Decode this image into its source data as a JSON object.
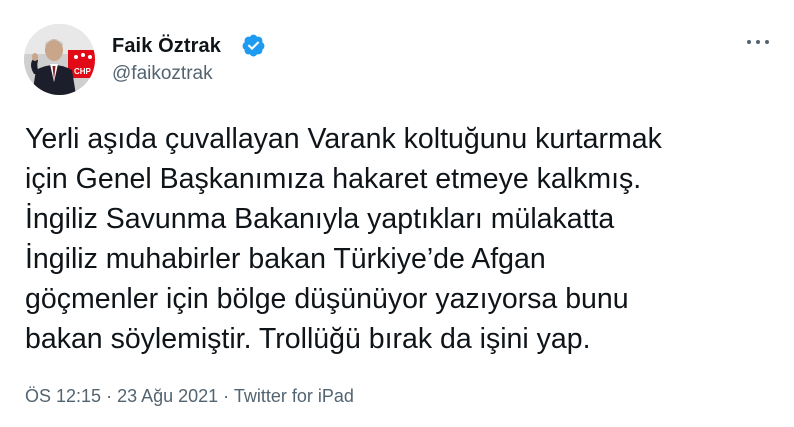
{
  "author": {
    "display_name": "Faik Öztrak",
    "handle": "@faikoztrak",
    "verified": true
  },
  "avatar": {
    "logo_text": "CHP"
  },
  "tweet": {
    "text": "Yerli aşıda çuvallayan Varank koltuğunu kurtarmak\niçin Genel Başkanımıza hakaret etmeye kalkmış.\nİngiliz Savunma Bakanıyla yaptıkları mülakatta\nİngiliz muhabirler bakan Türkiye’de Afgan\ngöçmenler için bölge düşünüyor yazıyorsa bunu\nbakan söylemiştir. Trollüğü bırak da işini yap."
  },
  "meta": {
    "time": "ÖS 12:15",
    "sep1": " · ",
    "date": "23 Ağu 2021",
    "sep2": " · ",
    "source": "Twitter for iPad"
  },
  "icons": {
    "verified": "verified-badge-icon",
    "more": "more-options-icon"
  },
  "colors": {
    "verified_blue": "#1d9bf0",
    "text_primary": "#0f1419",
    "text_secondary": "#536471",
    "chp_red": "#e30a17"
  }
}
